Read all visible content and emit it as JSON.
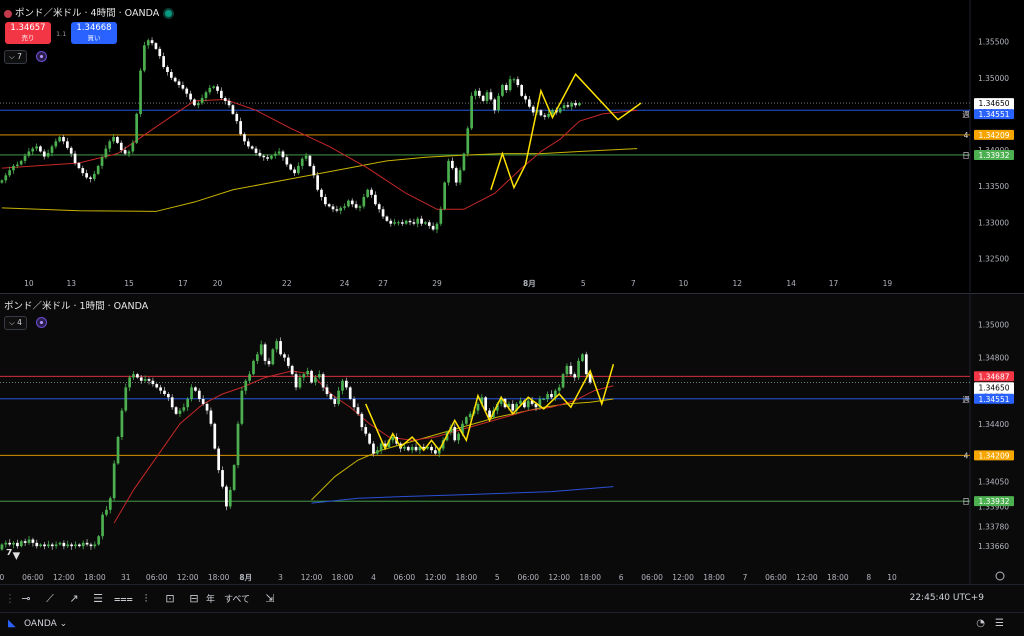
{
  "colors": {
    "up": "#4caf50",
    "down": "#ffffff",
    "wick": "#b0b0b0",
    "sell": "#f23645",
    "buy": "#2962ff",
    "weekly": "#2962ff",
    "h4line": "#f7a600",
    "daily": "#4caf50",
    "ma_red": "#c62828",
    "ma_yellow": "#c8b400",
    "ma_blue": "#2b50d6",
    "zigzag": "#ffe200",
    "last": "#ffffff"
  },
  "chart_top": {
    "title": "ポンド／米ドル · 4時間 · OANDA",
    "sell_price": "1.34657",
    "sell_label": "売り",
    "buy_price": "1.34668",
    "buy_label": "買い",
    "spread": "1.1",
    "indicator_count": "7",
    "right_labels": [
      {
        "text": "1.34650",
        "sub": "03:14:20",
        "kind": "last",
        "value": 1.3465
      },
      {
        "text": "1.34551",
        "kind": "weekly",
        "value": 1.34551,
        "marker": "週"
      },
      {
        "text": "1.34209",
        "kind": "h4line",
        "value": 1.34209,
        "marker": "4"
      },
      {
        "text": "1.33932",
        "kind": "daily",
        "value": 1.33932,
        "marker": "日"
      }
    ]
  },
  "chart_bottom": {
    "title": "ポンド／米ドル · 1時間 · OANDA",
    "indicator_count": "4",
    "right_labels": [
      {
        "text": "1.34687",
        "kind": "sell",
        "value": 1.34687
      },
      {
        "text": "1.34650",
        "sub": "14:20",
        "kind": "last",
        "value": 1.3465
      },
      {
        "text": "1.34551",
        "kind": "weekly",
        "value": 1.34551,
        "marker": "週"
      },
      {
        "text": "1.34209",
        "kind": "h4line",
        "value": 1.34209,
        "marker": "4"
      },
      {
        "text": "1.33932",
        "kind": "daily",
        "value": 1.33932,
        "marker": "日"
      }
    ]
  },
  "toolbar": {
    "range_year": "年",
    "range_all": "すべて",
    "clock": "22:45:40 UTC+9"
  },
  "bottom_bar": {
    "brand": "OANDA"
  },
  "chart_data": [
    {
      "type": "candlestick",
      "title": "ポンド／米ドル · 4時間 · OANDA",
      "ylim": [
        1.3245,
        1.358
      ],
      "y_ticks": [
        "1.35500",
        "1.35000",
        "1.34500",
        "1.34000",
        "1.33500",
        "1.33000",
        "1.32500"
      ],
      "y_tick_values": [
        1.355,
        1.35,
        1.345,
        1.34,
        1.335,
        1.33,
        1.325
      ],
      "x_ticks": [
        "10",
        "13",
        "15",
        "17",
        "20",
        "22",
        "24",
        "27",
        "29",
        "8月",
        "5",
        "7",
        "10",
        "12",
        "14",
        "17",
        "19"
      ],
      "bars_total": 170,
      "x_tick_bars": [
        7,
        18,
        33,
        47,
        56,
        74,
        89,
        99,
        113,
        137,
        151,
        164,
        177,
        191,
        205,
        216,
        230
      ],
      "closes": [
        1.3358,
        1.3365,
        1.3372,
        1.3378,
        1.338,
        1.3385,
        1.3392,
        1.3398,
        1.3402,
        1.3405,
        1.3398,
        1.3391,
        1.3396,
        1.3405,
        1.3412,
        1.3418,
        1.3412,
        1.3403,
        1.3395,
        1.3382,
        1.3375,
        1.3368,
        1.3362,
        1.336,
        1.3367,
        1.3378,
        1.339,
        1.3402,
        1.3412,
        1.3418,
        1.341,
        1.34,
        1.3395,
        1.3398,
        1.341,
        1.345,
        1.351,
        1.3545,
        1.3552,
        1.3548,
        1.354,
        1.353,
        1.3515,
        1.3508,
        1.35,
        1.3495,
        1.349,
        1.3485,
        1.3478,
        1.347,
        1.3462,
        1.3465,
        1.3472,
        1.348,
        1.3486,
        1.3488,
        1.3482,
        1.3472,
        1.3468,
        1.3462,
        1.345,
        1.344,
        1.3422,
        1.3412,
        1.3405,
        1.3402,
        1.3396,
        1.3392,
        1.339,
        1.3388,
        1.3392,
        1.3395,
        1.3398,
        1.339,
        1.338,
        1.3373,
        1.3368,
        1.3378,
        1.3388,
        1.3392,
        1.3378,
        1.3365,
        1.3345,
        1.3335,
        1.3325,
        1.3322,
        1.3318,
        1.3316,
        1.332,
        1.3322,
        1.333,
        1.3325,
        1.332,
        1.3322,
        1.3335,
        1.3345,
        1.3338,
        1.3325,
        1.3318,
        1.3308,
        1.3302,
        1.3298,
        1.33,
        1.33,
        1.3298,
        1.3302,
        1.33,
        1.3298,
        1.3305,
        1.3298,
        1.33,
        1.3295,
        1.329,
        1.3298,
        1.3318,
        1.3355,
        1.3385,
        1.3375,
        1.3355,
        1.3372,
        1.3395,
        1.343,
        1.3475,
        1.3482,
        1.3475,
        1.3468,
        1.348,
        1.347,
        1.3455,
        1.3475,
        1.349,
        1.3483,
        1.3498,
        1.3498,
        1.349,
        1.3475,
        1.347,
        1.346,
        1.3452,
        1.3455,
        1.3448,
        1.3446,
        1.345,
        1.3455,
        1.3452,
        1.3458,
        1.3462,
        1.346,
        1.3465,
        1.3462,
        1.3465
      ],
      "ma_red": [
        [
          0,
          1.3375
        ],
        [
          20,
          1.3382
        ],
        [
          30,
          1.3395
        ],
        [
          40,
          1.3432
        ],
        [
          50,
          1.3468
        ],
        [
          58,
          1.347
        ],
        [
          66,
          1.3455
        ],
        [
          75,
          1.343
        ],
        [
          85,
          1.3405
        ],
        [
          95,
          1.3375
        ],
        [
          105,
          1.334
        ],
        [
          113,
          1.3318
        ],
        [
          120,
          1.3318
        ],
        [
          128,
          1.334
        ],
        [
          135,
          1.3375
        ],
        [
          140,
          1.3398
        ],
        [
          145,
          1.3415
        ],
        [
          150,
          1.344
        ],
        [
          156,
          1.345
        ],
        [
          165,
          1.3455
        ]
      ],
      "ma_yellow": [
        [
          0,
          1.332
        ],
        [
          20,
          1.3316
        ],
        [
          40,
          1.3315
        ],
        [
          50,
          1.3328
        ],
        [
          60,
          1.3345
        ],
        [
          75,
          1.336
        ],
        [
          90,
          1.3375
        ],
        [
          100,
          1.3385
        ],
        [
          110,
          1.339
        ],
        [
          120,
          1.3393
        ],
        [
          130,
          1.3395
        ],
        [
          140,
          1.3395
        ],
        [
          150,
          1.3398
        ],
        [
          165,
          1.3402
        ]
      ],
      "zigzag": [
        [
          127,
          1.3345
        ],
        [
          130,
          1.3395
        ],
        [
          133,
          1.3348
        ],
        [
          136,
          1.338
        ],
        [
          140,
          1.3482
        ],
        [
          143,
          1.3445
        ],
        [
          149,
          1.3505
        ],
        [
          160,
          1.3442
        ],
        [
          166,
          1.3465
        ]
      ]
    },
    {
      "type": "candlestick",
      "title": "ポンド／米ドル · 1時間 · OANDA",
      "ylim": [
        1.3354,
        1.351
      ],
      "y_ticks": [
        "1.35000",
        "1.34800",
        "1.34550",
        "1.34400",
        "1.34200",
        "1.34050",
        "1.33900",
        "1.33780",
        "1.33660"
      ],
      "y_tick_values": [
        1.35,
        1.348,
        1.3455,
        1.344,
        1.342,
        1.3405,
        1.339,
        1.3378,
        1.3366
      ],
      "x_ticks": [
        "0",
        "06:00",
        "12:00",
        "18:00",
        "31",
        "06:00",
        "12:00",
        "18:00",
        "8月",
        "3",
        "12:00",
        "18:00",
        "4",
        "06:00",
        "12:00",
        "18:00",
        "5",
        "06:00",
        "12:00",
        "18:00",
        "6",
        "06:00",
        "12:00",
        "18:00",
        "7",
        "06:00",
        "12:00",
        "18:00",
        "8",
        "10"
      ],
      "bars_total": 170,
      "x_tick_bars": [
        0,
        8,
        16,
        24,
        32,
        40,
        48,
        56,
        63,
        72,
        80,
        88,
        96,
        104,
        112,
        120,
        128,
        136,
        144,
        152,
        160,
        168,
        176,
        184,
        192,
        200,
        208,
        216,
        224,
        230
      ],
      "closes": [
        1.3367,
        1.3368,
        1.3367,
        1.3368,
        1.3366,
        1.3369,
        1.3368,
        1.337,
        1.3368,
        1.3366,
        1.3367,
        1.3366,
        1.3367,
        1.3366,
        1.3367,
        1.3368,
        1.3366,
        1.3367,
        1.3366,
        1.3367,
        1.3366,
        1.3368,
        1.3367,
        1.3366,
        1.3367,
        1.3372,
        1.3385,
        1.3388,
        1.3395,
        1.3416,
        1.3432,
        1.3448,
        1.3462,
        1.3468,
        1.347,
        1.3468,
        1.3466,
        1.3467,
        1.3466,
        1.3464,
        1.3462,
        1.346,
        1.3458,
        1.3456,
        1.345,
        1.3446,
        1.3448,
        1.345,
        1.3455,
        1.3462,
        1.346,
        1.3455,
        1.3452,
        1.3448,
        1.344,
        1.3425,
        1.3412,
        1.3402,
        1.339,
        1.34,
        1.3415,
        1.344,
        1.346,
        1.3466,
        1.347,
        1.3478,
        1.3482,
        1.3488,
        1.3478,
        1.3476,
        1.3485,
        1.349,
        1.3482,
        1.348,
        1.3475,
        1.347,
        1.3462,
        1.3468,
        1.347,
        1.3472,
        1.3465,
        1.3468,
        1.347,
        1.3462,
        1.3458,
        1.3455,
        1.3452,
        1.346,
        1.3466,
        1.3462,
        1.3455,
        1.345,
        1.3446,
        1.3438,
        1.3434,
        1.3428,
        1.3422,
        1.3424,
        1.3428,
        1.3426,
        1.343,
        1.3432,
        1.3428,
        1.3425,
        1.3426,
        1.3424,
        1.3426,
        1.3424,
        1.3426,
        1.3425,
        1.3426,
        1.3424,
        1.3422,
        1.3425,
        1.343,
        1.3435,
        1.3438,
        1.343,
        1.3434,
        1.344,
        1.3444,
        1.3446,
        1.3448,
        1.3452,
        1.3456,
        1.3448,
        1.3444,
        1.3448,
        1.3452,
        1.3455,
        1.345,
        1.3452,
        1.3448,
        1.3452,
        1.3454,
        1.345,
        1.3454,
        1.3452,
        1.345,
        1.3455,
        1.3455,
        1.3458,
        1.3456,
        1.346,
        1.3462,
        1.347,
        1.3475,
        1.347,
        1.3468,
        1.3478,
        1.3482,
        1.347,
        1.3465
      ],
      "ma_red": [
        [
          29,
          1.338
        ],
        [
          34,
          1.34
        ],
        [
          40,
          1.342
        ],
        [
          46,
          1.344
        ],
        [
          52,
          1.3452
        ],
        [
          57,
          1.3458
        ],
        [
          62,
          1.3462
        ],
        [
          68,
          1.3468
        ],
        [
          75,
          1.3472
        ],
        [
          80,
          1.347
        ],
        [
          85,
          1.3458
        ],
        [
          90,
          1.345
        ],
        [
          95,
          1.344
        ],
        [
          100,
          1.3432
        ],
        [
          106,
          1.343
        ],
        [
          112,
          1.3432
        ],
        [
          118,
          1.3436
        ],
        [
          124,
          1.344
        ],
        [
          130,
          1.3444
        ],
        [
          136,
          1.3448
        ],
        [
          142,
          1.345
        ],
        [
          148,
          1.3454
        ],
        [
          153,
          1.346
        ],
        [
          158,
          1.3463
        ]
      ],
      "ma_yellow": [
        [
          80,
          1.3394
        ],
        [
          86,
          1.3408
        ],
        [
          92,
          1.3418
        ],
        [
          98,
          1.3424
        ],
        [
          104,
          1.3428
        ],
        [
          110,
          1.3432
        ],
        [
          116,
          1.3436
        ],
        [
          122,
          1.344
        ],
        [
          128,
          1.3444
        ],
        [
          134,
          1.3447
        ],
        [
          140,
          1.345
        ],
        [
          146,
          1.3452
        ],
        [
          152,
          1.3453
        ],
        [
          158,
          1.3455
        ]
      ],
      "ma_blue": [
        [
          80,
          1.3392
        ],
        [
          92,
          1.3395
        ],
        [
          104,
          1.3396
        ],
        [
          118,
          1.3397
        ],
        [
          130,
          1.3398
        ],
        [
          142,
          1.3399
        ],
        [
          158,
          1.3402
        ]
      ],
      "zigzag": [
        [
          94,
          1.3452
        ],
        [
          99,
          1.3425
        ],
        [
          101,
          1.3434
        ],
        [
          103,
          1.3426
        ],
        [
          106,
          1.3432
        ],
        [
          109,
          1.3424
        ],
        [
          111,
          1.343
        ],
        [
          113,
          1.3424
        ],
        [
          117,
          1.3442
        ],
        [
          120,
          1.343
        ],
        [
          123,
          1.3457
        ],
        [
          126,
          1.3442
        ],
        [
          129,
          1.3456
        ],
        [
          132,
          1.3446
        ],
        [
          136,
          1.3456
        ],
        [
          140,
          1.3449
        ],
        [
          144,
          1.3458
        ],
        [
          147,
          1.345
        ],
        [
          152,
          1.3472
        ],
        [
          155,
          1.3452
        ],
        [
          158,
          1.3476
        ]
      ]
    }
  ]
}
